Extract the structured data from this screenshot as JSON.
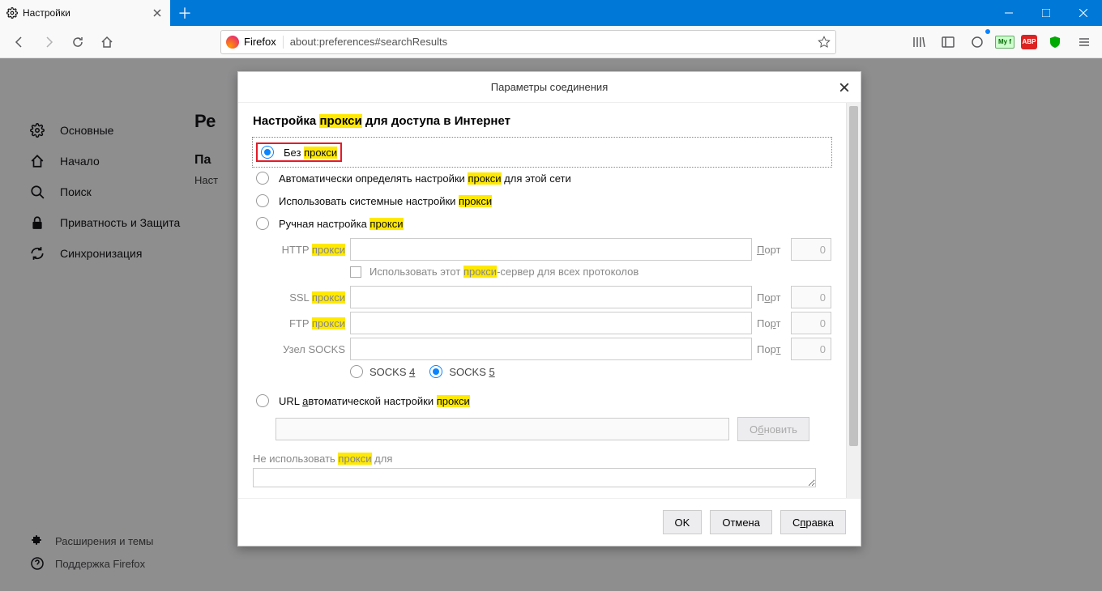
{
  "tab": {
    "title": "Настройки"
  },
  "urlbar": {
    "identity": "Firefox",
    "url": "about:preferences#searchResults"
  },
  "sidebar": {
    "items": [
      {
        "label": "Основные"
      },
      {
        "label": "Начало"
      },
      {
        "label": "Поиск"
      },
      {
        "label": "Приватность и Защита"
      },
      {
        "label": "Синхронизация"
      }
    ],
    "foot": [
      {
        "label": "Расширения и темы"
      },
      {
        "label": "Поддержка Firefox"
      }
    ]
  },
  "main": {
    "heading_prefix": "Ре",
    "subheading_prefix": "Па",
    "para_prefix": "Наст"
  },
  "dialog": {
    "title": "Параметры соединения",
    "section_before": "Настройка ",
    "section_hl": "прокси",
    "section_after": " для доступа в Интернет",
    "r1_before": "Без ",
    "r1_hl": "прокси",
    "r2_before": "Автоматически определять настройки ",
    "r2_hl": "прокси",
    "r2_after": " для этой сети",
    "r3_before": "Использовать системные настройки ",
    "r3_hl": "прокси",
    "r4_before": "Ручная настройка ",
    "r4_hl": "прокси",
    "http_label_before": "HTTP ",
    "http_label_hl": "прокси",
    "port_label": "Порт",
    "port_value": "0",
    "useforall_before": "Использовать этот ",
    "useforall_hl": "прокси",
    "useforall_after": "-сервер для всех протоколов",
    "ssl_before": "SSL ",
    "ssl_hl": "прокси",
    "ftp_before": "FTP ",
    "ftp_hl": "прокси",
    "socksnode": "Узел SOCKS",
    "socks4_a": "SOCKS ",
    "socks4_b": "4",
    "socks5_a": "SOCKS ",
    "socks5_b": "5",
    "pac_before": "URL ",
    "pac_ul": "а",
    "pac_mid": "втоматической настройки ",
    "pac_hl": "прокси",
    "reload_before": "О",
    "reload_ul": "б",
    "reload_after": "новить",
    "noproxy_before": "Не использовать ",
    "noproxy_hl": "прокси",
    "noproxy_after": " для",
    "ok": "OK",
    "cancel": "Отмена",
    "help_before": "С",
    "help_ul": "п",
    "help_after": "равка"
  }
}
